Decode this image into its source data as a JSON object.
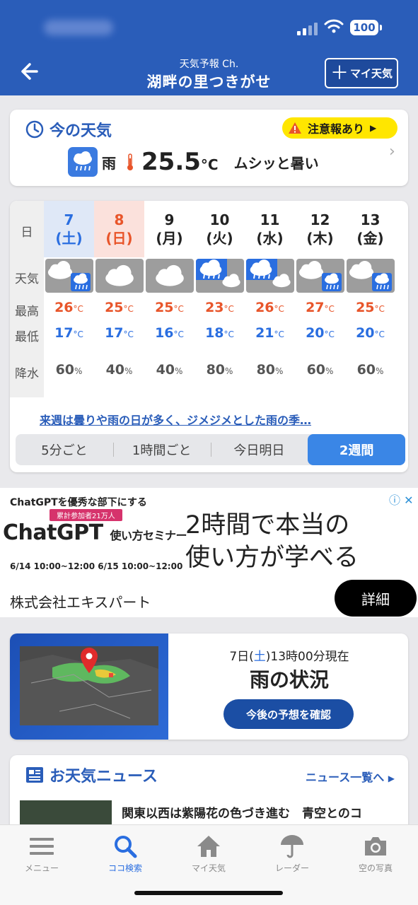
{
  "status_bar": {
    "battery": "100"
  },
  "header": {
    "back_label": "戻る",
    "subtitle": "天気予報 Ch.",
    "title": "湖畔の里つきがせ",
    "my_weather_button": "マイ天気"
  },
  "now": {
    "title": "今の天気",
    "warning": "注意報あり",
    "condition": "雨",
    "temperature": "25.5",
    "unit": "°C",
    "feel": "ムシッと暑い"
  },
  "forecast": {
    "row_labels": {
      "day": "日",
      "weather": "天気",
      "high": "最高",
      "low": "最低",
      "precip": "降水"
    },
    "days": [
      {
        "date": "7",
        "dow": "(土)",
        "type": "sat",
        "icon": "cloudy-then-rain",
        "high": "26",
        "low": "17",
        "precip": "60"
      },
      {
        "date": "8",
        "dow": "(日)",
        "type": "sun",
        "icon": "cloudy",
        "high": "25",
        "low": "17",
        "precip": "40"
      },
      {
        "date": "9",
        "dow": "(月)",
        "type": "weekday",
        "icon": "cloudy",
        "high": "25",
        "low": "16",
        "precip": "40"
      },
      {
        "date": "10",
        "dow": "(火)",
        "type": "weekday",
        "icon": "rain-then-cloudy",
        "high": "23",
        "low": "18",
        "precip": "80"
      },
      {
        "date": "11",
        "dow": "(水)",
        "type": "weekday",
        "icon": "rain-then-cloudy",
        "high": "26",
        "low": "21",
        "precip": "80"
      },
      {
        "date": "12",
        "dow": "(木)",
        "type": "weekday",
        "icon": "cloudy-then-rain",
        "high": "27",
        "low": "20",
        "precip": "60"
      },
      {
        "date": "13",
        "dow": "(金)",
        "type": "weekday",
        "icon": "cloudy-then-rain",
        "high": "25",
        "low": "20",
        "precip": "60"
      }
    ],
    "temp_unit": "°C",
    "precip_unit": "%",
    "headline": "来週は曇りや雨の日が多く、ジメジメとした雨の季…",
    "tabs": [
      "5分ごと",
      "1時間ごと",
      "今日明日",
      "2週間"
    ],
    "active_tab": "2週間"
  },
  "ad": {
    "tagline": "ChatGPTを優秀な部下にする",
    "badge": "累計参加者21万人",
    "brand": "ChatGPT",
    "brand_sub": "使い方セミナー",
    "dates": "6/14 10:00~12:00  6/15 10:00~12:00",
    "headline_1": "2時間で本当の",
    "headline_2": "使い方が学べる",
    "company": "株式会社エキスパート",
    "cta": "詳細"
  },
  "radar": {
    "time_prefix": "7日(",
    "time_day": "土",
    "time_suffix": ")13時00分現在",
    "title": "雨の状況",
    "button": "今後の予想を確認"
  },
  "news": {
    "title": "お天気ニュース",
    "all_link": "ニュース一覧へ",
    "headline": "関東以西は紫陽花の色づき進む　青空とのコ"
  },
  "tab_bar": {
    "items": [
      "メニュー",
      "ココ検索",
      "マイ天気",
      "レーダー",
      "空の写真"
    ],
    "active": "ココ検索"
  },
  "colors": {
    "brand": "#2a5db9",
    "high": "#e8552a",
    "low": "#2a6ee0",
    "warning": "#ffe600",
    "saturday_bg": "#dfe8f7",
    "sunday_bg": "#fbe1dc"
  }
}
